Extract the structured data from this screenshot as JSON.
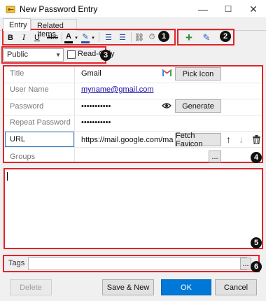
{
  "window": {
    "title": "New Password Entry",
    "controls": {
      "minimize": "—",
      "maximize": "☐",
      "close": "✕"
    }
  },
  "tabs": [
    {
      "label": "Entry",
      "active": true
    },
    {
      "label": "Related Items",
      "active": false
    }
  ],
  "toolbar": {
    "bold": "B",
    "italic": "I",
    "underline": "U",
    "strike": "abc",
    "font_color": "A",
    "highlight": "✎",
    "bullets": "☰",
    "numbers": "☰",
    "link": "⛓",
    "date": "⏱",
    "add": "+",
    "edit": "✎"
  },
  "badges": [
    "1",
    "2",
    "3",
    "4",
    "5",
    "6"
  ],
  "visibility": {
    "selected": "Public",
    "readonly_label": "Read-Only",
    "readonly_checked": false
  },
  "fields": {
    "title": {
      "label": "Title",
      "value": "Gmail",
      "button": "Pick Icon"
    },
    "username": {
      "label": "User Name",
      "value": "myname@gmail.com"
    },
    "password": {
      "label": "Password",
      "value": "•••••••••••",
      "button": "Generate"
    },
    "repeat_password": {
      "label": "Repeat Password",
      "value": "•••••••••••"
    },
    "url": {
      "label": "URL",
      "value": "https://mail.google.com/mail/u",
      "button": "Fetch Favicon"
    },
    "groups": {
      "label": "Groups",
      "value": "",
      "button": "..."
    }
  },
  "notes": {
    "value": ""
  },
  "tags": {
    "label": "Tags",
    "value": "",
    "button": "..."
  },
  "buttons": {
    "delete": "Delete",
    "save_new": "Save & New",
    "ok": "OK",
    "cancel": "Cancel"
  },
  "colors": {
    "accent": "#0078d7",
    "annotation": "#e2252b",
    "add_green": "#2e8b3d",
    "link": "#1a0dab"
  },
  "icons": [
    "app-key-icon",
    "gmail-icon",
    "eye-icon",
    "arrow-up-icon",
    "arrow-down-icon",
    "trash-icon"
  ]
}
